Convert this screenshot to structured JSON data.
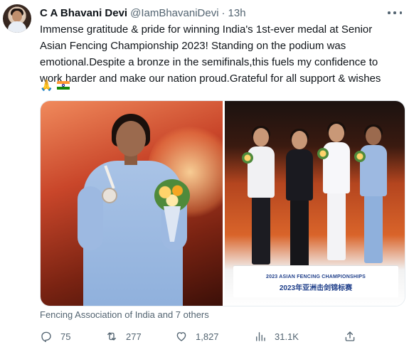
{
  "tweet": {
    "author_name": "C A Bhavani Devi",
    "author_handle": "@IamBhavaniDevi",
    "separator": "·",
    "time": "13h",
    "text": "Immense gratitude & pride for winning India's 1st-ever medal at Senior Asian Fencing Championship 2023! Standing on the podium was emotional.Despite a bronze in the semifinals,this fuels my confidence to work harder and make our nation proud.Grateful for all support & wishes",
    "emojis": [
      "folded-hands",
      "india-flag"
    ],
    "photo_text": {
      "podium_line1": "2023 ASIAN FENCING CHAMPIONSHIPS",
      "podium_line2": "2023年亚洲击剑锦标赛"
    },
    "tagged": "Fencing Association of India and 7 others"
  },
  "actions": {
    "replies": "75",
    "retweets": "277",
    "likes": "1,827",
    "views": "31.1K"
  },
  "icons": {
    "more": "more-horizontal-icon",
    "reply": "reply-icon",
    "retweet": "retweet-icon",
    "like": "heart-icon",
    "views": "views-chart-icon",
    "share": "share-icon"
  },
  "colors": {
    "text": "#0f1419",
    "secondary": "#536471",
    "podium_blue": "#1f3f8a"
  }
}
